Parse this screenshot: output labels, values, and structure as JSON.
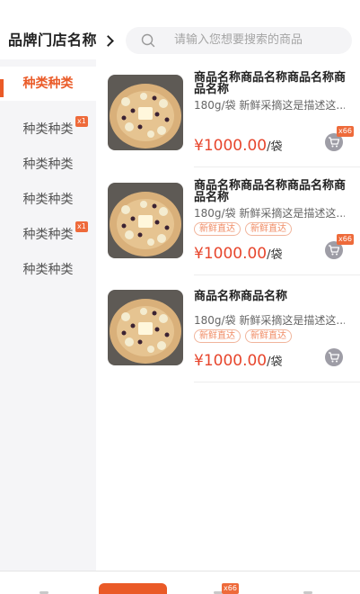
{
  "header": {
    "brand": "品牌门店名称",
    "search_placeholder": "请输入您想要搜索的商品"
  },
  "sidebar": {
    "items": [
      {
        "label": "种类种类",
        "active": true,
        "badge": ""
      },
      {
        "label": "种类种类",
        "active": false,
        "badge": "x1"
      },
      {
        "label": "种类种类",
        "active": false,
        "badge": ""
      },
      {
        "label": "种类种类",
        "active": false,
        "badge": ""
      },
      {
        "label": "种类种类",
        "active": false,
        "badge": "x1"
      },
      {
        "label": "种类种类",
        "active": false,
        "badge": ""
      }
    ]
  },
  "products": [
    {
      "name": "商品名称商品名称商品名称商品名称",
      "desc": "180g/袋 新鲜采摘这是描述这...",
      "tags": [],
      "price": "¥1000.00",
      "unit": "/袋",
      "cart_badge": "x66"
    },
    {
      "name": "商品名称商品名称商品名称商品名称",
      "desc": "180g/袋 新鲜采摘这是描述这...",
      "tags": [
        "新鲜直达",
        "新鲜直达"
      ],
      "price": "¥1000.00",
      "unit": "/袋",
      "cart_badge": "x66"
    },
    {
      "name": "商品名称商品名称",
      "desc": "180g/袋 新鲜采摘这是描述这...",
      "tags": [
        "新鲜直达",
        "新鲜直达"
      ],
      "price": "¥1000.00",
      "unit": "/袋",
      "cart_badge": ""
    }
  ],
  "tabbar": {
    "cart_badge": "x66"
  },
  "colors": {
    "accent": "#ea5a27",
    "price": "#e7462d",
    "badge": "#ee6a3a"
  },
  "icons": {
    "brand_chevron": "chevron-right-icon",
    "search": "search-icon",
    "cart": "cart-icon"
  }
}
